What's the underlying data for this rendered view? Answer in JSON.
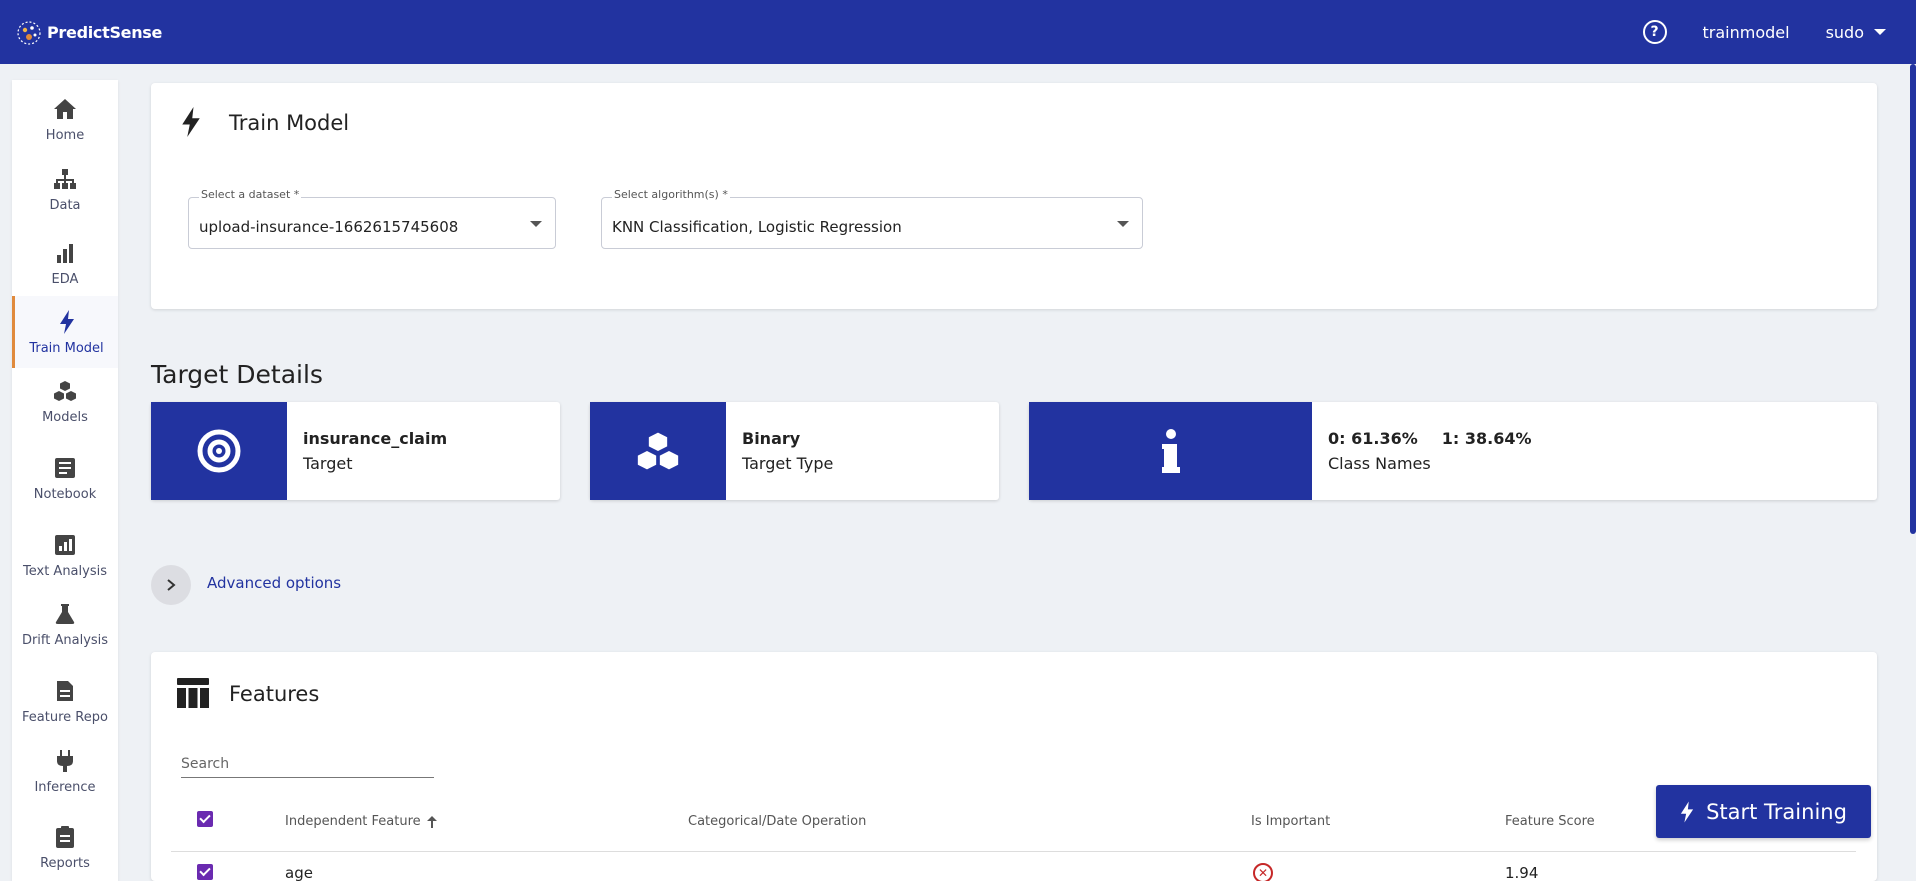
{
  "app": {
    "name": "PredictSense"
  },
  "header": {
    "help_icon": "help-circle-icon",
    "page_link": "trainmodel",
    "user": "sudo"
  },
  "sidebar": {
    "items": [
      {
        "label": "Home",
        "icon": "home-icon"
      },
      {
        "label": "Data",
        "icon": "sitemap-icon"
      },
      {
        "label": "EDA",
        "icon": "bar-chart-icon"
      },
      {
        "label": "Train Model",
        "icon": "bolt-icon",
        "active": true
      },
      {
        "label": "Models",
        "icon": "cubes-icon"
      },
      {
        "label": "Notebook",
        "icon": "book-icon"
      },
      {
        "label": "Text Analysis",
        "icon": "chart-square-icon"
      },
      {
        "label": "Drift Analysis",
        "icon": "flask-icon"
      },
      {
        "label": "Feature Repo",
        "icon": "document-icon"
      },
      {
        "label": "Inference",
        "icon": "plug-icon"
      },
      {
        "label": "Reports",
        "icon": "clipboard-icon"
      }
    ]
  },
  "train": {
    "title": "Train Model",
    "dataset_label": "Select a dataset *",
    "dataset_value": "upload-insurance-1662615745608",
    "algorithm_label": "Select algorithm(s) *",
    "algorithm_value": "KNN Classification, Logistic Regression"
  },
  "target": {
    "section_title": "Target Details",
    "cards": [
      {
        "value": "insurance_claim",
        "label": "Target",
        "icon": "target-icon"
      },
      {
        "value": "Binary",
        "label": "Target Type",
        "icon": "cubes-icon"
      },
      {
        "class_0": "0: 61.36%",
        "class_1": "1: 38.64%",
        "label": "Class Names",
        "icon": "info-icon"
      }
    ]
  },
  "advanced": {
    "label": "Advanced options"
  },
  "features": {
    "title": "Features",
    "search_placeholder": "Search",
    "columns": [
      "Independent Feature",
      "Categorical/Date Operation",
      "Is Important",
      "Feature Score"
    ],
    "rows": [
      {
        "feature": "age",
        "operation": "",
        "is_important": false,
        "score": "1.94"
      }
    ]
  },
  "actions": {
    "start_training": "Start Training"
  },
  "colors": {
    "primary": "#2233a0",
    "accent": "#e08a3c",
    "checkbox": "#6a2ab0",
    "error": "#c62828"
  }
}
